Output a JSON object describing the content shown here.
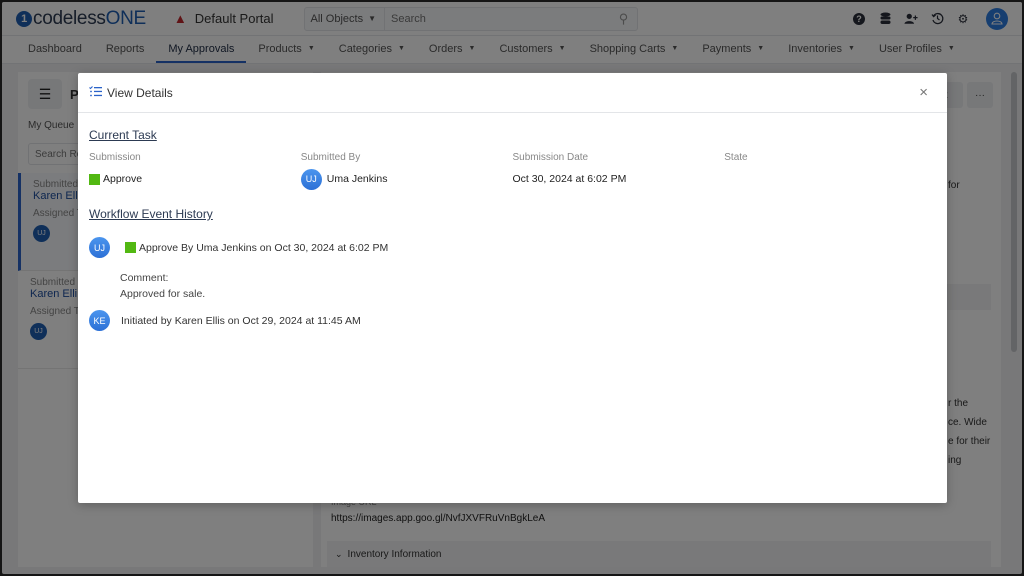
{
  "header": {
    "brand_prefix": "codeless",
    "brand_suffix": "ONE",
    "portal_name": "Default Portal",
    "search_scope": "All Objects",
    "search_placeholder": "Search",
    "icons": [
      "help-icon",
      "database-icon",
      "add-user-icon",
      "history-icon",
      "gear-icon",
      "user-avatar-icon"
    ]
  },
  "nav": {
    "items": [
      {
        "label": "Dashboard",
        "dropdown": false,
        "active": false
      },
      {
        "label": "Reports",
        "dropdown": false,
        "active": false
      },
      {
        "label": "My Approvals",
        "dropdown": false,
        "active": true
      },
      {
        "label": "Products",
        "dropdown": true,
        "active": false
      },
      {
        "label": "Categories",
        "dropdown": true,
        "active": false
      },
      {
        "label": "Orders",
        "dropdown": true,
        "active": false
      },
      {
        "label": "Customers",
        "dropdown": true,
        "active": false
      },
      {
        "label": "Shopping Carts",
        "dropdown": true,
        "active": false
      },
      {
        "label": "Payments",
        "dropdown": true,
        "active": false
      },
      {
        "label": "Inventories",
        "dropdown": true,
        "active": false
      },
      {
        "label": "User Profiles",
        "dropdown": true,
        "active": false
      }
    ]
  },
  "background": {
    "left": {
      "title_partial": "P",
      "tab": "My Queue",
      "search_partial": "Search Re",
      "cards": [
        {
          "submitted": "Submitted",
          "name": "Karen Elli",
          "assigned": "Assigned T",
          "initials": "UJ"
        },
        {
          "submitted": "Submitted",
          "name": "Karen Elli",
          "assigned": "Assigned T",
          "initials": "UJ"
        }
      ]
    },
    "right": {
      "edit_partial": "it",
      "more": "···",
      "snippet_1": "for",
      "desc_lines": [
        "r the",
        "ce. Wide",
        "e for their",
        "ing"
      ],
      "image_url_label": "Image URL",
      "image_url": "https://images.app.goo.gl/NvfJXVFRuVnBgkLeA",
      "section": "Inventory Information"
    }
  },
  "modal": {
    "title": "View Details",
    "close": "×",
    "current_task": {
      "heading": "Current Task",
      "submission_label": "Submission",
      "submission_value": "Approve",
      "submitted_by_label": "Submitted By",
      "submitted_by_initials": "UJ",
      "submitted_by_name": "Uma Jenkins",
      "date_label": "Submission Date",
      "date_value": "Oct 30, 2024 at 6:02 PM",
      "state_label": "State",
      "state_value": ""
    },
    "history": {
      "heading": "Workflow Event History",
      "events": [
        {
          "initials": "UJ",
          "text": "Approve By Uma Jenkins on Oct 30, 2024 at 6:02 PM",
          "comment_label": "Comment:",
          "comment": "Approved for sale."
        },
        {
          "initials": "KE",
          "text": "Initiated by Karen Ellis on Oct 29, 2024 at 11:45 AM"
        }
      ]
    },
    "status_color": "#52b812",
    "accent_color": "#2a62c9"
  }
}
